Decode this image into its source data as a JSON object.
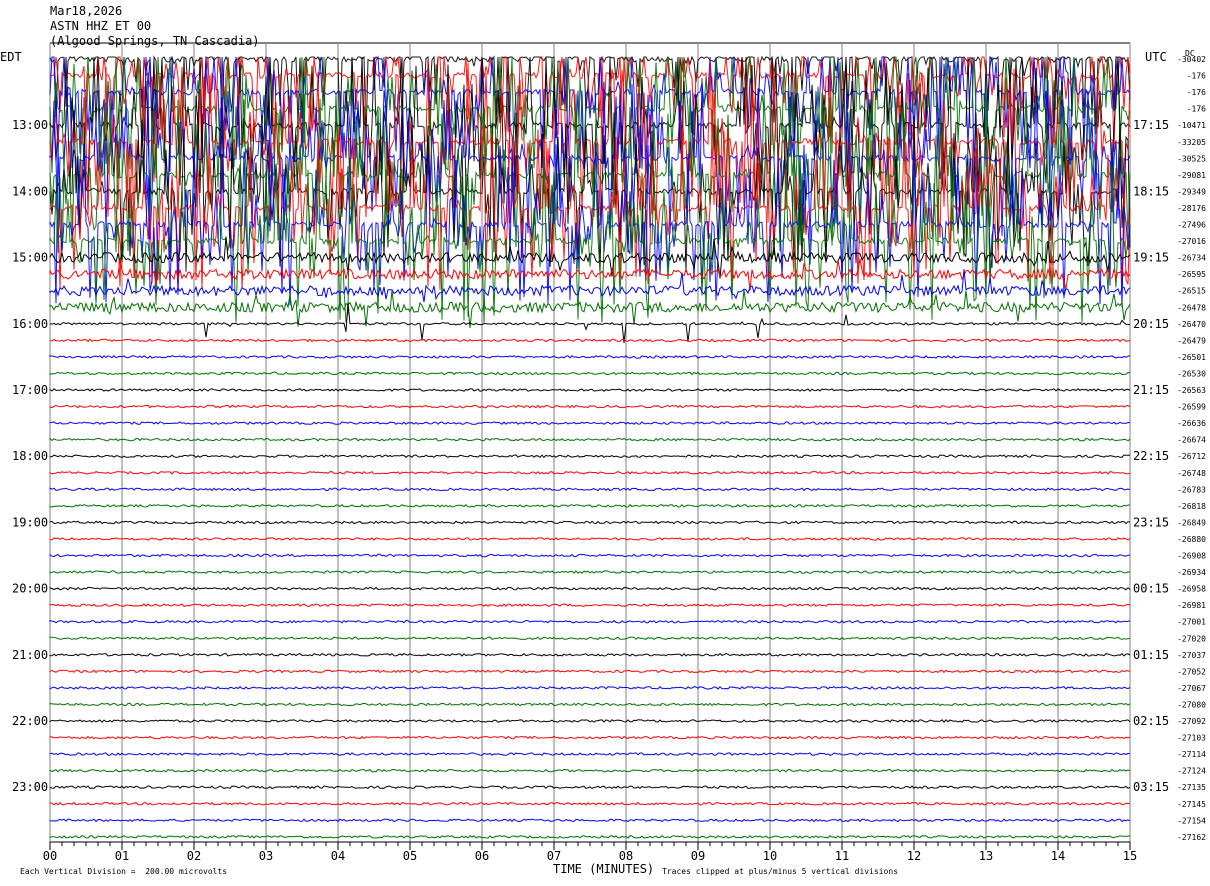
{
  "header": {
    "date": "Mar18,2026",
    "station": "ASTN HHZ ET 00",
    "location": "(Algood Springs, TN Cascadia)"
  },
  "left_timezone": "EDT",
  "right_timezone": "UTC",
  "dc_label": "DC",
  "chart_data": {
    "type": "line",
    "title": "",
    "xlabel": "TIME (MINUTES)",
    "ylabel": "",
    "x_ticks": [
      "00",
      "01",
      "02",
      "03",
      "04",
      "05",
      "06",
      "07",
      "08",
      "09",
      "10",
      "11",
      "12",
      "13",
      "14",
      "15"
    ],
    "xlim": [
      0,
      15
    ],
    "grid": true,
    "left_hour_labels": [
      "13:00",
      "14:00",
      "15:00",
      "16:00",
      "17:00",
      "18:00",
      "19:00",
      "20:00",
      "21:00",
      "22:00",
      "23:00"
    ],
    "right_hour_labels": [
      "17:15",
      "18:15",
      "19:15",
      "20:15",
      "21:15",
      "22:15",
      "23:15",
      "00:15",
      "01:15",
      "02:15",
      "03:15"
    ],
    "trace_colors": [
      "#000000",
      "#ff0000",
      "#0000ff",
      "#007000"
    ],
    "dc_offsets": [
      "-30402",
      "-176",
      "-176",
      "-176",
      "-10471",
      "-33205",
      "-30525",
      "-29081",
      "-29349",
      "-28176",
      "-27496",
      "-27016",
      "-26734",
      "-26595",
      "-26515",
      "-26478",
      "-26470",
      "-26479",
      "-26501",
      "-26530",
      "-26563",
      "-26599",
      "-26636",
      "-26674",
      "-26712",
      "-26748",
      "-26783",
      "-26818",
      "-26849",
      "-26880",
      "-26908",
      "-26934",
      "-26958",
      "-26981",
      "-27001",
      "-27020",
      "-27037",
      "-27052",
      "-27067",
      "-27080",
      "-27092",
      "-27103",
      "-27114",
      "-27124",
      "-27135",
      "-27145",
      "-27154",
      "-27162"
    ]
  },
  "footer": {
    "scale_note": "Each Vertical Division =  200.00 microvolts",
    "clip_note": "Traces clipped at plus/minus 5 vertical divisions"
  }
}
